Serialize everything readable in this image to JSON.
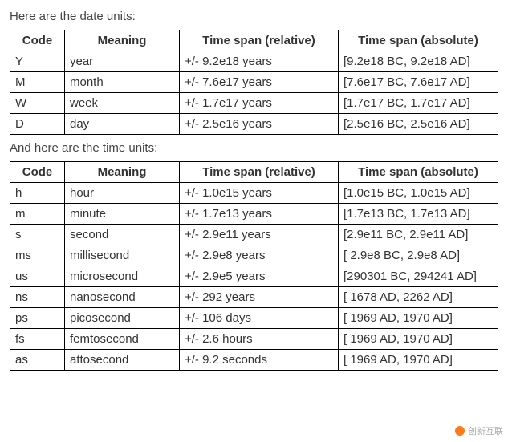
{
  "intro_date": "Here are the date units:",
  "intro_time": "And here are the time units:",
  "headers": {
    "code": "Code",
    "meaning": "Meaning",
    "rel": "Time span (relative)",
    "abs": "Time span (absolute)"
  },
  "date_units": [
    {
      "code": "Y",
      "meaning": "year",
      "rel": "+/- 9.2e18 years",
      "abs": "[9.2e18 BC, 9.2e18 AD]"
    },
    {
      "code": "M",
      "meaning": "month",
      "rel": "+/- 7.6e17 years",
      "abs": "[7.6e17 BC, 7.6e17 AD]"
    },
    {
      "code": "W",
      "meaning": "week",
      "rel": "+/- 1.7e17 years",
      "abs": "[1.7e17 BC, 1.7e17 AD]"
    },
    {
      "code": "D",
      "meaning": "day",
      "rel": "+/- 2.5e16 years",
      "abs": "[2.5e16 BC, 2.5e16 AD]"
    }
  ],
  "time_units": [
    {
      "code": "h",
      "meaning": "hour",
      "rel": "+/- 1.0e15 years",
      "abs": "[1.0e15 BC, 1.0e15 AD]"
    },
    {
      "code": "m",
      "meaning": "minute",
      "rel": "+/- 1.7e13 years",
      "abs": "[1.7e13 BC, 1.7e13 AD]"
    },
    {
      "code": "s",
      "meaning": "second",
      "rel": "+/- 2.9e11 years",
      "abs": "[2.9e11 BC, 2.9e11 AD]"
    },
    {
      "code": "ms",
      "meaning": "millisecond",
      "rel": "+/- 2.9e8 years",
      "abs": "[ 2.9e8 BC, 2.9e8 AD]"
    },
    {
      "code": "us",
      "meaning": "microsecond",
      "rel": "+/- 2.9e5 years",
      "abs": "[290301 BC, 294241 AD]"
    },
    {
      "code": "ns",
      "meaning": "nanosecond",
      "rel": "+/- 292 years",
      "abs": "[ 1678 AD, 2262 AD]"
    },
    {
      "code": "ps",
      "meaning": "picosecond",
      "rel": "+/- 106 days",
      "abs": "[ 1969 AD, 1970 AD]"
    },
    {
      "code": "fs",
      "meaning": "femtosecond",
      "rel": "+/- 2.6 hours",
      "abs": "[ 1969 AD, 1970 AD]"
    },
    {
      "code": "as",
      "meaning": "attosecond",
      "rel": "+/- 9.2 seconds",
      "abs": "[ 1969 AD, 1970 AD]"
    }
  ],
  "watermark": "创新互联"
}
